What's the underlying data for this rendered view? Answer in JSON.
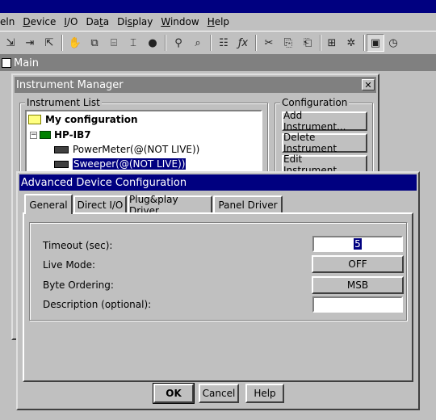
{
  "menu": [
    "eln",
    "Device",
    "I/O",
    "Data",
    "Display",
    "Window",
    "Help"
  ],
  "menu_underline": [
    "",
    "D",
    "I",
    "t",
    "s",
    "W",
    "H"
  ],
  "main_window": {
    "title": "Main"
  },
  "instrument_manager": {
    "title": "Instrument Manager",
    "list_group": "Instrument List",
    "config_group": "Configuration",
    "tree": {
      "root": "My configuration",
      "interface": "HP-IB7",
      "devices": [
        "PowerMeter(@(NOT LIVE))",
        "Sweeper(@(NOT LIVE))"
      ]
    },
    "buttons": [
      "Add Instrument...",
      "Delete Instrument",
      "Edit Instrument..."
    ]
  },
  "advanced_dialog": {
    "title": "Advanced Device Configuration",
    "tabs": [
      "General",
      "Direct I/O",
      "Plug&play Driver",
      "Panel Driver"
    ],
    "active_tab": "General",
    "fields": {
      "timeout_label": "Timeout (sec):",
      "timeout_value": "5",
      "live_mode_label": "Live Mode:",
      "live_mode_value": "OFF",
      "byte_order_label": "Byte Ordering:",
      "byte_order_value": "MSB",
      "description_label": "Description (optional):",
      "description_value": ""
    },
    "ok": "OK",
    "cancel": "Cancel",
    "help": "Help"
  },
  "colors": {
    "active_title": "#000080",
    "inactive_title": "#808080",
    "face": "#c0c0c0"
  }
}
